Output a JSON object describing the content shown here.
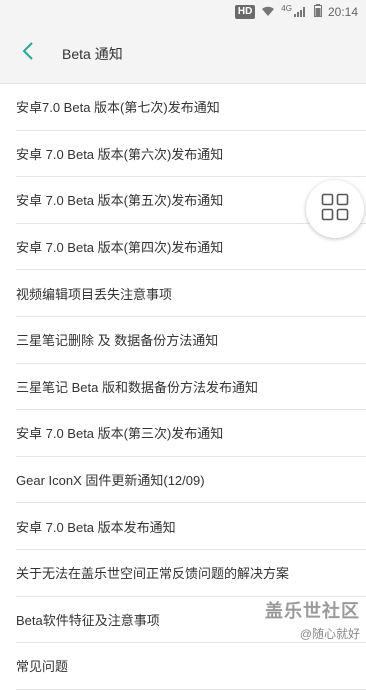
{
  "status_bar": {
    "hd": "HD",
    "network": "4G",
    "time": "20:14",
    "icons": [
      "wifi-icon",
      "signal-icon",
      "battery-icon"
    ]
  },
  "header": {
    "back_icon": "chevron-left-icon",
    "title": "Beta 通知",
    "accent_color": "#26a69a"
  },
  "list": {
    "items": [
      "安卓7.0 Beta 版本(第七次)发布通知",
      "安卓 7.0 Beta 版本(第六次)发布通知",
      "安卓 7.0 Beta 版本(第五次)发布通知",
      "安卓 7.0 Beta 版本(第四次)发布通知",
      "视频编辑项目丢失注意事项",
      "三星笔记删除 及 数据备份方法通知",
      "三星笔记 Beta 版和数据备份方法发布通知",
      "安卓 7.0 Beta 版本(第三次)发布通知",
      "Gear IconX 固件更新通知(12/09)",
      "安卓 7.0 Beta 版本发布通知",
      "关于无法在盖乐世空间正常反馈问题的解决方案",
      "Beta软件特征及注意事项",
      "常见问题"
    ]
  },
  "floating_button": {
    "icon": "grid-icon"
  },
  "watermark": {
    "title": "盖乐世社区",
    "subtitle": "@随心就好"
  }
}
